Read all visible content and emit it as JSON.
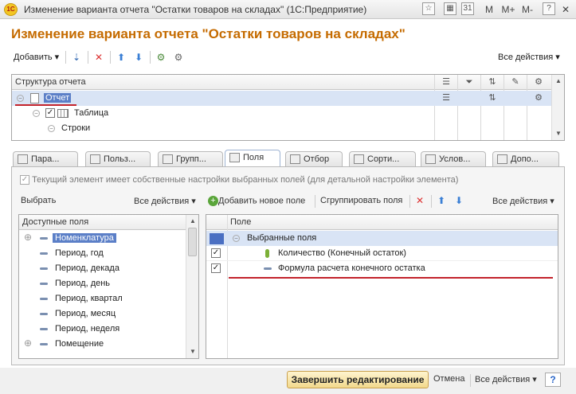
{
  "window": {
    "title": "Изменение варианта отчета \"Остатки товаров на складах\"  (1С:Предприятие)",
    "logo": "1С",
    "btn_m": "M",
    "btn_mplus": "M+",
    "btn_mminus": "M-"
  },
  "heading": "Изменение варианта отчета \"Остатки товаров на складах\"",
  "toolbar": {
    "add_label": "Добавить",
    "all_actions": "Все действия"
  },
  "structure": {
    "header": "Структура отчета",
    "rows": [
      {
        "label": "Отчет"
      },
      {
        "label": "Таблица"
      },
      {
        "label": "Строки"
      }
    ]
  },
  "tabs": [
    {
      "label": "Пара..."
    },
    {
      "label": "Польз..."
    },
    {
      "label": "Групп..."
    },
    {
      "label": "Поля"
    },
    {
      "label": "Отбор"
    },
    {
      "label": "Сорти..."
    },
    {
      "label": "Услов..."
    },
    {
      "label": "Допо..."
    }
  ],
  "fields_panel": {
    "own_settings_text": "Текущий элемент имеет собственные настройки выбранных полей (для детальной настройки элемента)",
    "select_label": "Выбрать",
    "all_actions_left": "Все действия",
    "add_new_field": "Добавить новое поле",
    "group_fields": "Сгруппировать поля",
    "all_actions_right": "Все действия",
    "available_header": "Доступные поля",
    "available_fields": [
      "Номенклатура",
      "Период, год",
      "Период, декада",
      "Период, день",
      "Период, квартал",
      "Период, месяц",
      "Период, неделя",
      "Помещение"
    ],
    "field_header": "Поле",
    "selected_group": "Выбранные поля",
    "selected_fields": [
      {
        "label": "Количество (Конечный остаток)",
        "checked": true
      },
      {
        "label": "Формула расчета конечного остатка",
        "checked": true
      }
    ]
  },
  "footer": {
    "finish_label": "Завершить редактирование",
    "cancel_label": "Отмена",
    "all_actions": "Все действия"
  },
  "colors": {
    "heading": "#c56b00",
    "selection": "#d9e4f5",
    "underline": "#c3232b"
  }
}
